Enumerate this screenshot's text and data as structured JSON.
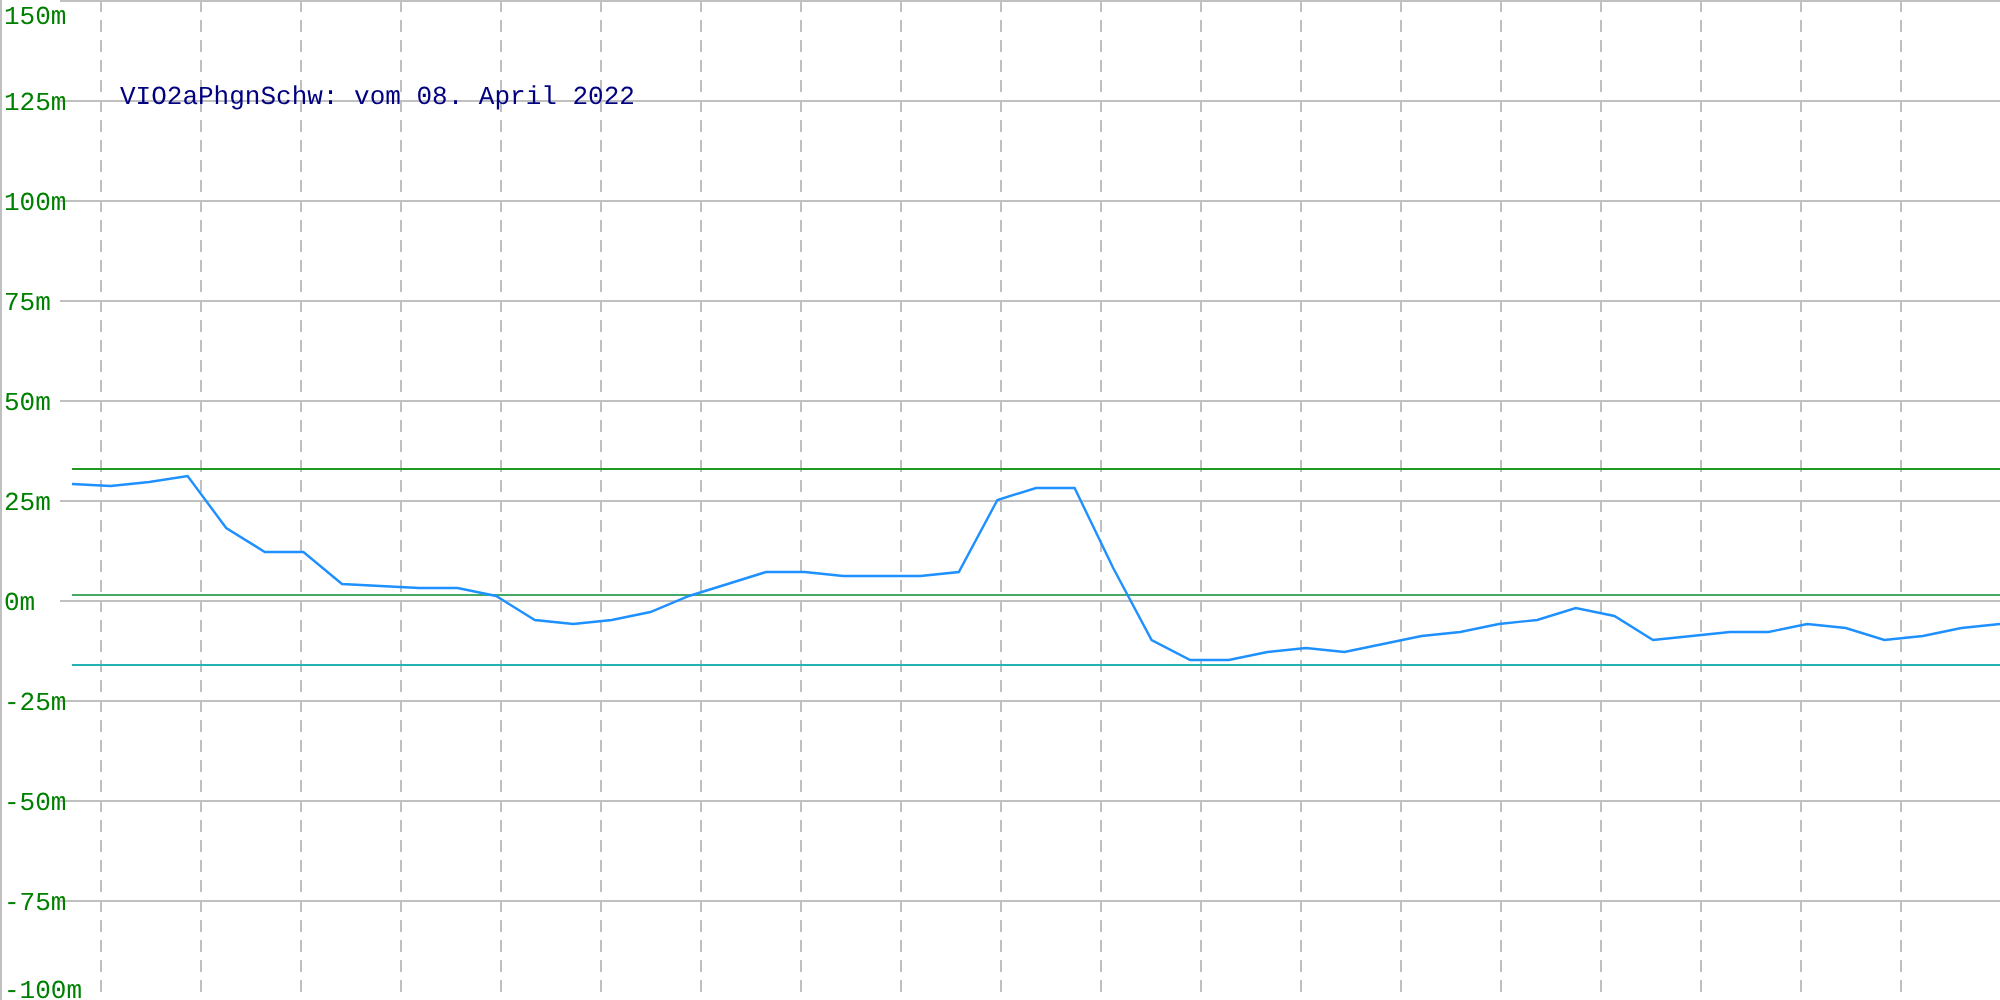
{
  "chart": {
    "chart_data": {
      "type": "line",
      "title": "VIO2aPhgnSchw: vom 08. April 2022",
      "categories": [
        null,
        null,
        null,
        null,
        null,
        null,
        null,
        null,
        null,
        null,
        null,
        null,
        null,
        null,
        null,
        null,
        null,
        null,
        null,
        null,
        null,
        null,
        null,
        null,
        null,
        null,
        null,
        null,
        null,
        null,
        null,
        null,
        null,
        null,
        null,
        null,
        null,
        null,
        null,
        null,
        null,
        null,
        null,
        null,
        null,
        null,
        null,
        null,
        null,
        null,
        null
      ],
      "grid": true,
      "series": [
        {
          "color": "#1e90ff",
          "values": [
            29,
            28.5,
            29.5,
            31,
            18,
            12,
            12,
            4,
            3.5,
            3,
            3,
            1,
            -5,
            -6,
            -5,
            -3,
            1,
            4,
            7,
            7,
            6,
            6,
            6,
            7,
            25,
            28,
            28,
            8,
            -10,
            -15,
            -15,
            -13,
            -12,
            -13,
            -11,
            -9,
            -8,
            -6,
            -5,
            -2,
            -4,
            -10,
            -9,
            -8,
            -8,
            -6,
            -7,
            -10,
            -9,
            -7,
            -6
          ]
        },
        {
          "color": "#229922",
          "values": [
            33,
            33,
            33,
            33,
            33,
            33,
            33,
            33,
            33,
            33,
            33,
            33,
            33,
            33,
            33,
            33,
            33,
            33,
            33,
            33,
            33,
            33,
            33,
            33,
            33,
            33,
            33,
            33,
            33,
            33,
            33,
            33,
            33,
            33,
            33,
            33,
            33,
            33,
            33,
            33,
            33,
            33,
            33,
            33,
            33,
            33,
            33,
            33,
            33,
            33,
            33
          ]
        },
        {
          "color": "#44aa66",
          "values": [
            1.5,
            1.5,
            1.5,
            1.5,
            1.5,
            1.5,
            1.5,
            1.5,
            1.5,
            1.5,
            1.5,
            1.5,
            1.5,
            1.5,
            1.5,
            1.5,
            1.5,
            1.5,
            1.5,
            1.5,
            1.5,
            1.5,
            1.5,
            1.5,
            1.5,
            1.5,
            1.5,
            1.5,
            1.5,
            1.5,
            1.5,
            1.5,
            1.5,
            1.5,
            1.5,
            1.5,
            1.5,
            1.5,
            1.5,
            1.5,
            1.5,
            1.5,
            1.5,
            1.5,
            1.5,
            1.5,
            1.5,
            1.5,
            1.5,
            1.5,
            1.5
          ]
        },
        {
          "color": "#22b4b4",
          "values": [
            -16,
            -16,
            -16,
            -16,
            -16,
            -16,
            -16,
            -16,
            -16,
            -16,
            -16,
            -16,
            -16,
            -16,
            -16,
            -16,
            -16,
            -16,
            -16,
            -16,
            -16,
            -16,
            -16,
            -16,
            -16,
            -16,
            -16,
            -16,
            -16,
            -16,
            -16,
            -16,
            -16,
            -16,
            -16,
            -16,
            -16,
            -16,
            -16,
            -16,
            -16,
            -16,
            -16,
            -16,
            -16,
            -16,
            -16,
            -16,
            -16,
            -16,
            -16
          ]
        }
      ],
      "ylim": [
        -100,
        150
      ],
      "yticks": [
        {
          "value": 150,
          "label": "150m"
        },
        {
          "value": 125,
          "label": "125m"
        },
        {
          "value": 100,
          "label": "100m"
        },
        {
          "value": 75,
          "label": "75m"
        },
        {
          "value": 50,
          "label": "50m"
        },
        {
          "value": 25,
          "label": "25m"
        },
        {
          "value": 0,
          "label": "0m"
        },
        {
          "value": -25,
          "label": "-25m"
        },
        {
          "value": -50,
          "label": "-50m"
        },
        {
          "value": -75,
          "label": "-75m"
        },
        {
          "value": -100,
          "label": "-100m"
        }
      ]
    }
  }
}
